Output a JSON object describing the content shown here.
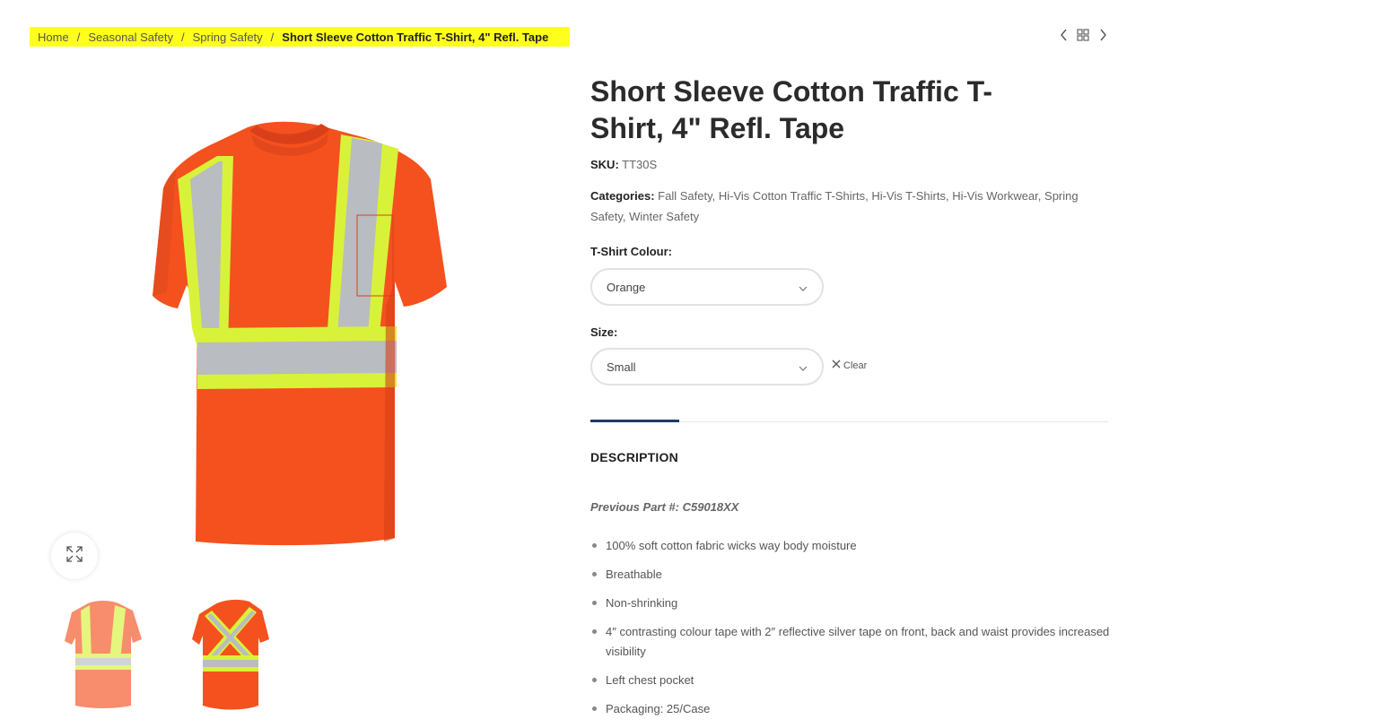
{
  "breadcrumb": {
    "items": [
      "Home",
      "Seasonal Safety",
      "Spring Safety"
    ],
    "separator": "/",
    "current": "Short Sleeve Cotton Traffic T-Shirt, 4\" Refl. Tape",
    "highlight_color": "#ffff1e"
  },
  "nav": {
    "prev_icon": "chevron-left-icon",
    "grid_icon": "grid-icon",
    "next_icon": "chevron-right-icon"
  },
  "product": {
    "title": "Short Sleeve Cotton Traffic T-Shirt, 4\" Refl. Tape",
    "sku_label": "SKU:",
    "sku": "TT30S",
    "categories_label": "Categories:",
    "categories": [
      "Fall Safety",
      "Hi-Vis Cotton Traffic T-Shirts",
      "Hi-Vis T-Shirts",
      "Hi-Vis Workwear",
      "Spring Safety",
      "Winter Safety"
    ]
  },
  "options": {
    "colour_label": "T-Shirt Colour",
    "colour_value": "Orange",
    "size_label": "Size",
    "size_value": "Small",
    "clear_label": "Clear"
  },
  "description": {
    "tab_label": "DESCRIPTION",
    "previous_part": "Previous Part #: C59018XX",
    "bullets": [
      "100% soft cotton fabric wicks way body moisture",
      "Breathable",
      "Non-shrinking",
      "4″ contrasting colour tape with 2″ reflective silver tape on front, back and waist provides increased visibility",
      "Left chest pocket",
      "Packaging: 25/Case"
    ]
  },
  "colors": {
    "shirt_orange": "#f4511e",
    "tape_yellow": "#d8f23a",
    "tape_silver": "#b9bcc0",
    "accent_navy": "#1d3c66"
  }
}
